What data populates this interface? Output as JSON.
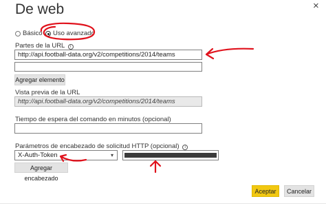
{
  "dialog": {
    "title": "De web",
    "close_glyph": "×"
  },
  "mode": {
    "basic_label": "Básico",
    "advanced_label": "Uso avanzado",
    "selected": "Uso avanzado"
  },
  "url_parts": {
    "label": "Partes de la URL",
    "info_icon": "info-icon",
    "value": "http://api.football-data.org/v2/competitions/2014/teams",
    "second_value": "",
    "add_button": "Agregar elemento"
  },
  "preview": {
    "label": "Vista previa de la URL",
    "value": "http://api.football-data.org/v2/competitions/2014/teams"
  },
  "timeout": {
    "label": "Tiempo de espera del comando en minutos (opcional)",
    "value": ""
  },
  "headers": {
    "label": "Parámetros de encabezado de solicitud HTTP (opcional)",
    "info_icon": "info-icon",
    "selected_header": "X-Auth-Token",
    "dropdown_icon": "chevron-down-icon",
    "add_button": "Agregar encabezado"
  },
  "footer": {
    "ok_label": "Aceptar",
    "cancel_label": "Cancelar"
  },
  "colors": {
    "accent": "#f2c811",
    "annotation": "#e0121c"
  }
}
